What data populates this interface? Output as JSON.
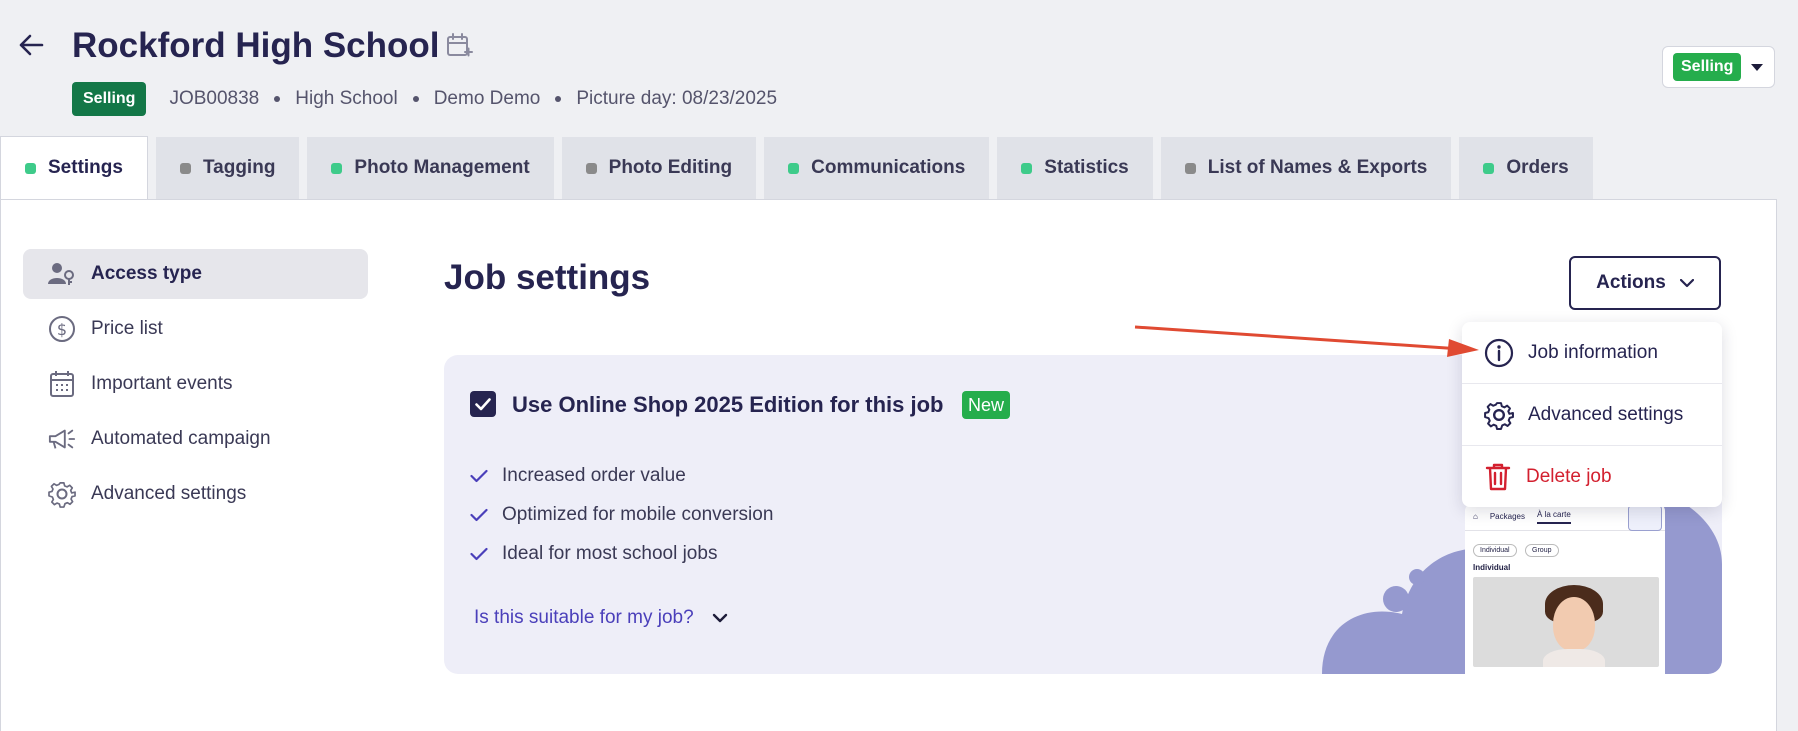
{
  "header": {
    "title": "Rockford High School",
    "status_badge": "Selling",
    "job_id": "JOB00838",
    "job_type": "High School",
    "owner": "Demo Demo",
    "picture_day": "Picture day: 08/23/2025",
    "status_dropdown_value": "Selling"
  },
  "tabs": [
    {
      "label": "Settings",
      "dot_color": "#3ecb8a"
    },
    {
      "label": "Tagging",
      "dot_color": "#8a8a8a"
    },
    {
      "label": "Photo Management",
      "dot_color": "#3ecb8a"
    },
    {
      "label": "Photo Editing",
      "dot_color": "#8a8a8a"
    },
    {
      "label": "Communications",
      "dot_color": "#3ecb8a"
    },
    {
      "label": "Statistics",
      "dot_color": "#3ecb8a"
    },
    {
      "label": "List of Names & Exports",
      "dot_color": "#8a8a8a"
    },
    {
      "label": "Orders",
      "dot_color": "#3ecb8a"
    }
  ],
  "sidebar": {
    "items": [
      {
        "label": "Access type",
        "icon": "user-key-icon"
      },
      {
        "label": "Price list",
        "icon": "dollar-circle-icon"
      },
      {
        "label": "Important events",
        "icon": "calendar-icon"
      },
      {
        "label": "Automated campaign",
        "icon": "megaphone-icon"
      },
      {
        "label": "Advanced settings",
        "icon": "gear-icon"
      }
    ]
  },
  "main": {
    "title": "Job settings",
    "actions_label": "Actions",
    "card": {
      "title": "Use Online Shop 2025 Edition for this job",
      "new_badge": "New",
      "checked": true,
      "benefits": [
        "Increased order value",
        "Optimized for mobile conversion",
        "Ideal for most school jobs"
      ],
      "link": "Is this suitable for my job?"
    },
    "preview": {
      "tab1": "Packages",
      "tab2": "À la carte",
      "chip1": "Individual",
      "chip2": "Group",
      "section": "Individual"
    }
  },
  "actions_menu": {
    "items": [
      {
        "label": "Job information",
        "icon": "info-circle-icon"
      },
      {
        "label": "Advanced settings",
        "icon": "gear-icon"
      },
      {
        "label": "Delete job",
        "icon": "trash-icon",
        "color": "#d3202f"
      }
    ]
  },
  "colors": {
    "primary": "#262450",
    "badge_dark_green": "#137747",
    "badge_green": "#25ad4c",
    "link": "#4a3fba",
    "danger": "#d3202f",
    "accent_blob": "#9599cf",
    "annotation_arrow": "#e04a32"
  }
}
